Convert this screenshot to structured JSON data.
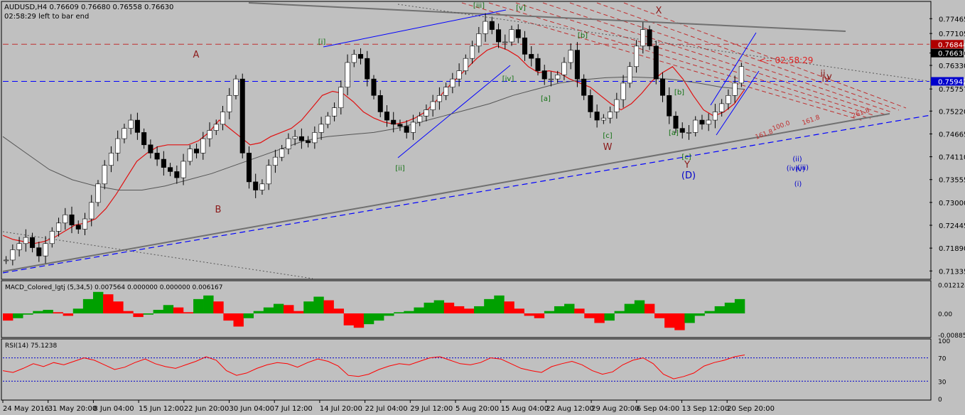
{
  "header": {
    "symbol_line": "AUDUSD,H4  0.76609 0.76680 0.76558 0.76630",
    "timer": "02:58:29 left to bar end"
  },
  "colors": {
    "background": "#c0c0c0",
    "grid_frame": "#000000",
    "candles": "#000000",
    "ma_fast": "#e01010",
    "ma_slow": "#555555",
    "trendline_gray": "#707070",
    "channel_blue": "#0000ff",
    "fib_red": "#c03030",
    "wave_green": "#107010",
    "wave_brown": "#8b1a1a",
    "wave_blue": "#0000cc",
    "macd_up": "#00a000",
    "macd_down": "#ff0000",
    "rsi_line": "#ff0000",
    "price_badge_red": "#b00000",
    "price_badge_black": "#000000",
    "price_badge_blue": "#0000cc"
  },
  "chart_data": [
    {
      "type": "candlestick",
      "title": "AUDUSD,H4",
      "ohlc_last": {
        "open": 0.76609,
        "high": 0.7668,
        "low": 0.76558,
        "close": 0.7663
      },
      "ylim": [
        0.7115,
        0.7785
      ],
      "y_ticks": [
        "0.77465",
        "0.77105",
        "0.76630",
        "0.76330",
        "0.75757",
        "0.75220",
        "0.74665",
        "0.74110",
        "0.73555",
        "0.73000",
        "0.72445",
        "0.71890",
        "0.71335"
      ],
      "x_ticks": [
        "24 May 2016",
        "31 May 20:00",
        "8 Jun 04:00",
        "15 Jun 12:00",
        "22 Jun 20:00",
        "30 Jun 04:00",
        "7 Jul 12:00",
        "14 Jul 20:00",
        "22 Jul 04:00",
        "29 Jul 12:00",
        "5 Aug 20:00",
        "15 Aug 04:00",
        "22 Aug 12:00",
        "29 Aug 20:00",
        "6 Sep 04:00",
        "13 Sep 12:00",
        "20 Sep 20:00"
      ],
      "price_badges": [
        {
          "value": "0.76844",
          "style": "red"
        },
        {
          "value": "0.76630",
          "style": "black"
        },
        {
          "value": "0.75942",
          "style": "blue"
        }
      ],
      "horizontal_lines": [
        {
          "price": 0.76844,
          "style": "red-dashed"
        },
        {
          "price": 0.75942,
          "style": "blue-dashed"
        }
      ],
      "close_series": [
        0.716,
        0.7185,
        0.72,
        0.7215,
        0.719,
        0.717,
        0.72,
        0.723,
        0.725,
        0.727,
        0.7245,
        0.7235,
        0.726,
        0.73,
        0.7345,
        0.739,
        0.742,
        0.7455,
        0.748,
        0.75,
        0.747,
        0.744,
        0.742,
        0.7405,
        0.7385,
        0.7375,
        0.736,
        0.74,
        0.743,
        0.742,
        0.7455,
        0.7475,
        0.749,
        0.752,
        0.756,
        0.76,
        0.742,
        0.735,
        0.733,
        0.7345,
        0.739,
        0.741,
        0.743,
        0.7455,
        0.746,
        0.745,
        0.7445,
        0.747,
        0.749,
        0.751,
        0.753,
        0.758,
        0.764,
        0.766,
        0.765,
        0.76,
        0.756,
        0.752,
        0.75,
        0.749,
        0.7485,
        0.747,
        0.7495,
        0.751,
        0.7525,
        0.7545,
        0.756,
        0.758,
        0.76,
        0.762,
        0.765,
        0.768,
        0.771,
        0.774,
        0.772,
        0.769,
        0.769,
        0.772,
        0.77,
        0.766,
        0.765,
        0.762,
        0.76,
        0.76,
        0.761,
        0.764,
        0.767,
        0.76,
        0.756,
        0.752,
        0.75,
        0.7505,
        0.752,
        0.755,
        0.759,
        0.763,
        0.768,
        0.772,
        0.768,
        0.76,
        0.756,
        0.751,
        0.748,
        0.747,
        0.747,
        0.75,
        0.749,
        0.75,
        0.752,
        0.754,
        0.756,
        0.759,
        0.763
      ],
      "ma_fast_series": [
        0.722,
        0.721,
        0.7205,
        0.72,
        0.7205,
        0.7215,
        0.723,
        0.7245,
        0.725,
        0.726,
        0.7285,
        0.732,
        0.736,
        0.74,
        0.742,
        0.7435,
        0.744,
        0.744,
        0.744,
        0.745,
        0.747,
        0.75,
        0.748,
        0.746,
        0.744,
        0.7445,
        0.746,
        0.747,
        0.748,
        0.75,
        0.753,
        0.756,
        0.757,
        0.7565,
        0.7545,
        0.752,
        0.7505,
        0.7495,
        0.749,
        0.7495,
        0.7505,
        0.752,
        0.7545,
        0.7575,
        0.76,
        0.7625,
        0.765,
        0.767,
        0.768,
        0.767,
        0.7655,
        0.763,
        0.7615,
        0.762,
        0.7615,
        0.76,
        0.759,
        0.758,
        0.756,
        0.754,
        0.7525,
        0.754,
        0.7565,
        0.7595,
        0.7615,
        0.763,
        0.76,
        0.756,
        0.7525,
        0.751,
        0.752,
        0.754,
        0.7575
      ],
      "ma_slow_series": [
        0.746,
        0.742,
        0.738,
        0.7355,
        0.734,
        0.733,
        0.733,
        0.734,
        0.7355,
        0.737,
        0.739,
        0.741,
        0.743,
        0.745,
        0.746,
        0.7465,
        0.747,
        0.748,
        0.7495,
        0.751,
        0.7525,
        0.754,
        0.756,
        0.7575,
        0.759,
        0.7598,
        0.7603,
        0.7605,
        0.7603,
        0.7598,
        0.759,
        0.758,
        0.7575
      ]
    },
    {
      "type": "bar",
      "title": "MACD_Colored_lgtj (5,34,5)",
      "values_text": "0.007564 0.000000 0.000000 0.006167",
      "y_ticks": [
        "0.012124",
        "0.00",
        "-0.008854"
      ],
      "ylim": [
        -0.0095,
        0.0128
      ],
      "values": [
        -0.003,
        -0.002,
        -0.0005,
        0.001,
        0.0015,
        0.0005,
        -0.001,
        0.002,
        0.006,
        0.009,
        0.008,
        0.005,
        0.001,
        -0.0015,
        -0.0005,
        0.0015,
        0.0035,
        0.0025,
        0.0005,
        0.006,
        0.0075,
        0.005,
        -0.003,
        -0.0055,
        -0.002,
        0.001,
        0.0025,
        0.004,
        0.0035,
        0.001,
        0.005,
        0.007,
        0.0055,
        0.002,
        -0.005,
        -0.006,
        -0.0045,
        -0.003,
        -0.001,
        0.0005,
        0.001,
        0.0025,
        0.0045,
        0.0055,
        0.0045,
        0.003,
        0.002,
        0.003,
        0.006,
        0.0075,
        0.005,
        0.002,
        -0.001,
        -0.002,
        0.001,
        0.003,
        0.004,
        0.002,
        -0.002,
        -0.004,
        -0.003,
        0.001,
        0.004,
        0.0055,
        0.004,
        -0.002,
        -0.006,
        -0.007,
        -0.004,
        -0.001,
        0.001,
        0.003,
        0.0045,
        0.006
      ]
    },
    {
      "type": "line",
      "title": "RSI(14)",
      "value_text": "75.1238",
      "y_ticks": [
        "100",
        "70",
        "30",
        "0"
      ],
      "ylim": [
        0,
        100
      ],
      "levels": [
        70,
        30
      ],
      "values": [
        48,
        45,
        52,
        60,
        55,
        62,
        58,
        64,
        70,
        66,
        58,
        50,
        54,
        62,
        68,
        60,
        55,
        52,
        58,
        64,
        72,
        66,
        48,
        40,
        44,
        52,
        58,
        62,
        60,
        54,
        62,
        68,
        64,
        56,
        40,
        38,
        42,
        50,
        56,
        60,
        58,
        64,
        70,
        72,
        66,
        60,
        58,
        62,
        70,
        68,
        60,
        52,
        48,
        45,
        55,
        60,
        64,
        58,
        48,
        42,
        46,
        58,
        66,
        70,
        60,
        42,
        34,
        38,
        44,
        56,
        62,
        66,
        72,
        75
      ]
    }
  ],
  "wave_labels": {
    "green": [
      "[i]",
      "[ii]",
      "[iii]",
      "[iv]",
      "[v]",
      "[a]",
      "[b]",
      "[c]",
      "[a]",
      "[b]",
      "[c]"
    ],
    "brown": [
      "A",
      "B",
      "W",
      "X",
      "Y",
      "ii",
      "iv",
      "v"
    ],
    "blue": [
      "(D)",
      "(ii)",
      "(iv)",
      "(i)",
      "(iii)",
      "(v)"
    ]
  },
  "fib_labels": [
    "161.8",
    "100.0",
    "161.8",
    "261.8"
  ],
  "countdown": "<-- 02:58:29"
}
